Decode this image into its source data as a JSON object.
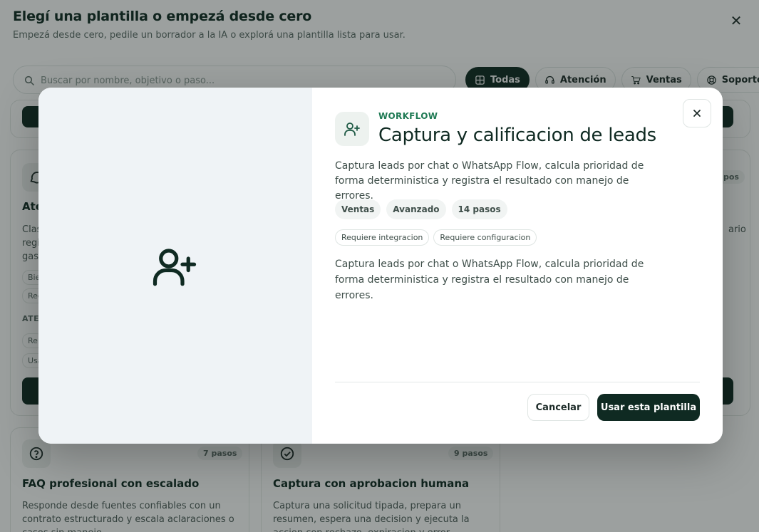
{
  "picker": {
    "title": "Elegí una plantilla o empezá desde cero",
    "subtitle": "Empezá desde cero, pedile un borrador a la IA o explorá una plantilla lista para usar.",
    "close_icon": "close-icon",
    "search": {
      "placeholder": "Buscar por nombre, objetivo o paso...",
      "icon": "search-icon"
    },
    "filters": [
      {
        "label": "Todas",
        "icon": "grid-icon",
        "active": true
      },
      {
        "label": "Atención",
        "icon": "headset-icon",
        "active": false
      },
      {
        "label": "Ventas",
        "icon": "cart-icon",
        "active": false
      },
      {
        "label": "Soporte",
        "icon": "lifebuoy-icon",
        "active": false
      }
    ],
    "cards": {
      "left_partial": {
        "title_fragment": "Ate",
        "desc_fragments": [
          "Clas",
          "regi",
          "gas"
        ],
        "tag_fragments": [
          "Bie",
          "Reg"
        ],
        "section_fragment": "ATE",
        "tag_fragments_2": [
          "Re",
          "Usa"
        ],
        "icon": "chat-icon"
      },
      "right_partial": {
        "steps_fragment": "pos",
        "desc_fragment": "ario"
      },
      "faq": {
        "title": "FAQ profesional con escalado",
        "steps": "7 pasos",
        "desc": "Responde desde fuentes confiables con un contrato estructurado y escala aclaraciones o casos sin manejo.",
        "icon": "help-circle-icon"
      },
      "approval": {
        "title": "Captura con aprobacion humana",
        "steps": "9 pasos",
        "desc": "Captura una solicitud tipada, prepara un resumen, espera una decision y ejecuta la accion con rechazo, expiracion y error.",
        "icon": "check-circle-icon"
      }
    }
  },
  "modal": {
    "eyebrow": "WORKFLOW",
    "title": "Captura y calificacion de leads",
    "description": "Captura leads por chat o WhatsApp Flow, calcula prioridad de forma deterministica y registra el resultado con manejo de errores.",
    "chips": [
      "Ventas",
      "Avanzado",
      "14 pasos"
    ],
    "requirements": [
      "Requiere integracion",
      "Requiere configuracion"
    ],
    "long_description": "Captura leads por chat o WhatsApp Flow, calcula prioridad de forma deterministica y registra el resultado con manejo de errores.",
    "cancel_label": "Cancelar",
    "use_label": "Usar esta plantilla",
    "icon": "user-plus-icon",
    "close_icon": "close-icon",
    "colors": {
      "accent": "#0f2a22",
      "eyebrow": "#1f7a54",
      "panel": "#eff3f6"
    }
  }
}
